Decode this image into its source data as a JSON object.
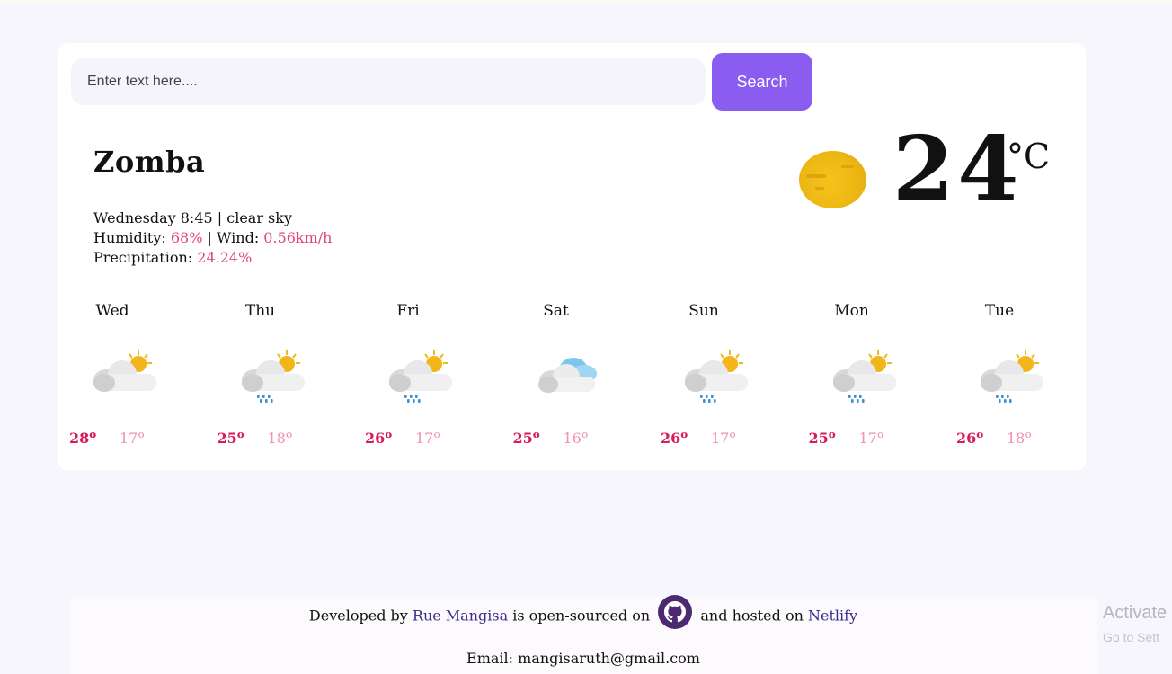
{
  "search": {
    "placeholder": "Enter text here....",
    "button_label": "Search"
  },
  "current": {
    "city": "Zomba",
    "day_time": "Wednesday 8:45",
    "condition": "clear sky",
    "humidity_label": "Humidity:",
    "humidity_value": "68%",
    "wind_label": "Wind:",
    "wind_value": "0.56km/h",
    "precip_label": "Precipitation:",
    "precip_value": "24.24%",
    "temperature": "24",
    "unit": "°C",
    "icon": "sun-icon"
  },
  "forecast": [
    {
      "day": "Wed",
      "icon": "cloud-sun-icon",
      "high": "28º",
      "low": "17º"
    },
    {
      "day": "Thu",
      "icon": "rain-sun-icon",
      "high": "25º",
      "low": "18º"
    },
    {
      "day": "Fri",
      "icon": "rain-sun-icon",
      "high": "26º",
      "low": "17º"
    },
    {
      "day": "Sat",
      "icon": "cloud-icon",
      "high": "25º",
      "low": "16º"
    },
    {
      "day": "Sun",
      "icon": "rain-sun-icon",
      "high": "26º",
      "low": "17º"
    },
    {
      "day": "Mon",
      "icon": "rain-sun-icon",
      "high": "25º",
      "low": "17º"
    },
    {
      "day": "Tue",
      "icon": "rain-sun-icon",
      "high": "26º",
      "low": "18º"
    }
  ],
  "footer": {
    "developed_by": "Developed by",
    "author": "Rue Mangisa",
    "open_sourced_on": "is open-sourced on",
    "hosted_on": "and hosted on",
    "host": "Netlify",
    "email": "Email: mangisaruth@gmail.com"
  },
  "watermark": {
    "title": "Activate",
    "subtitle": "Go to Sett"
  },
  "colors": {
    "accent": "#8a5cf0",
    "pink": "#e0447e",
    "high": "#d81b60",
    "low": "#f08fb0"
  }
}
